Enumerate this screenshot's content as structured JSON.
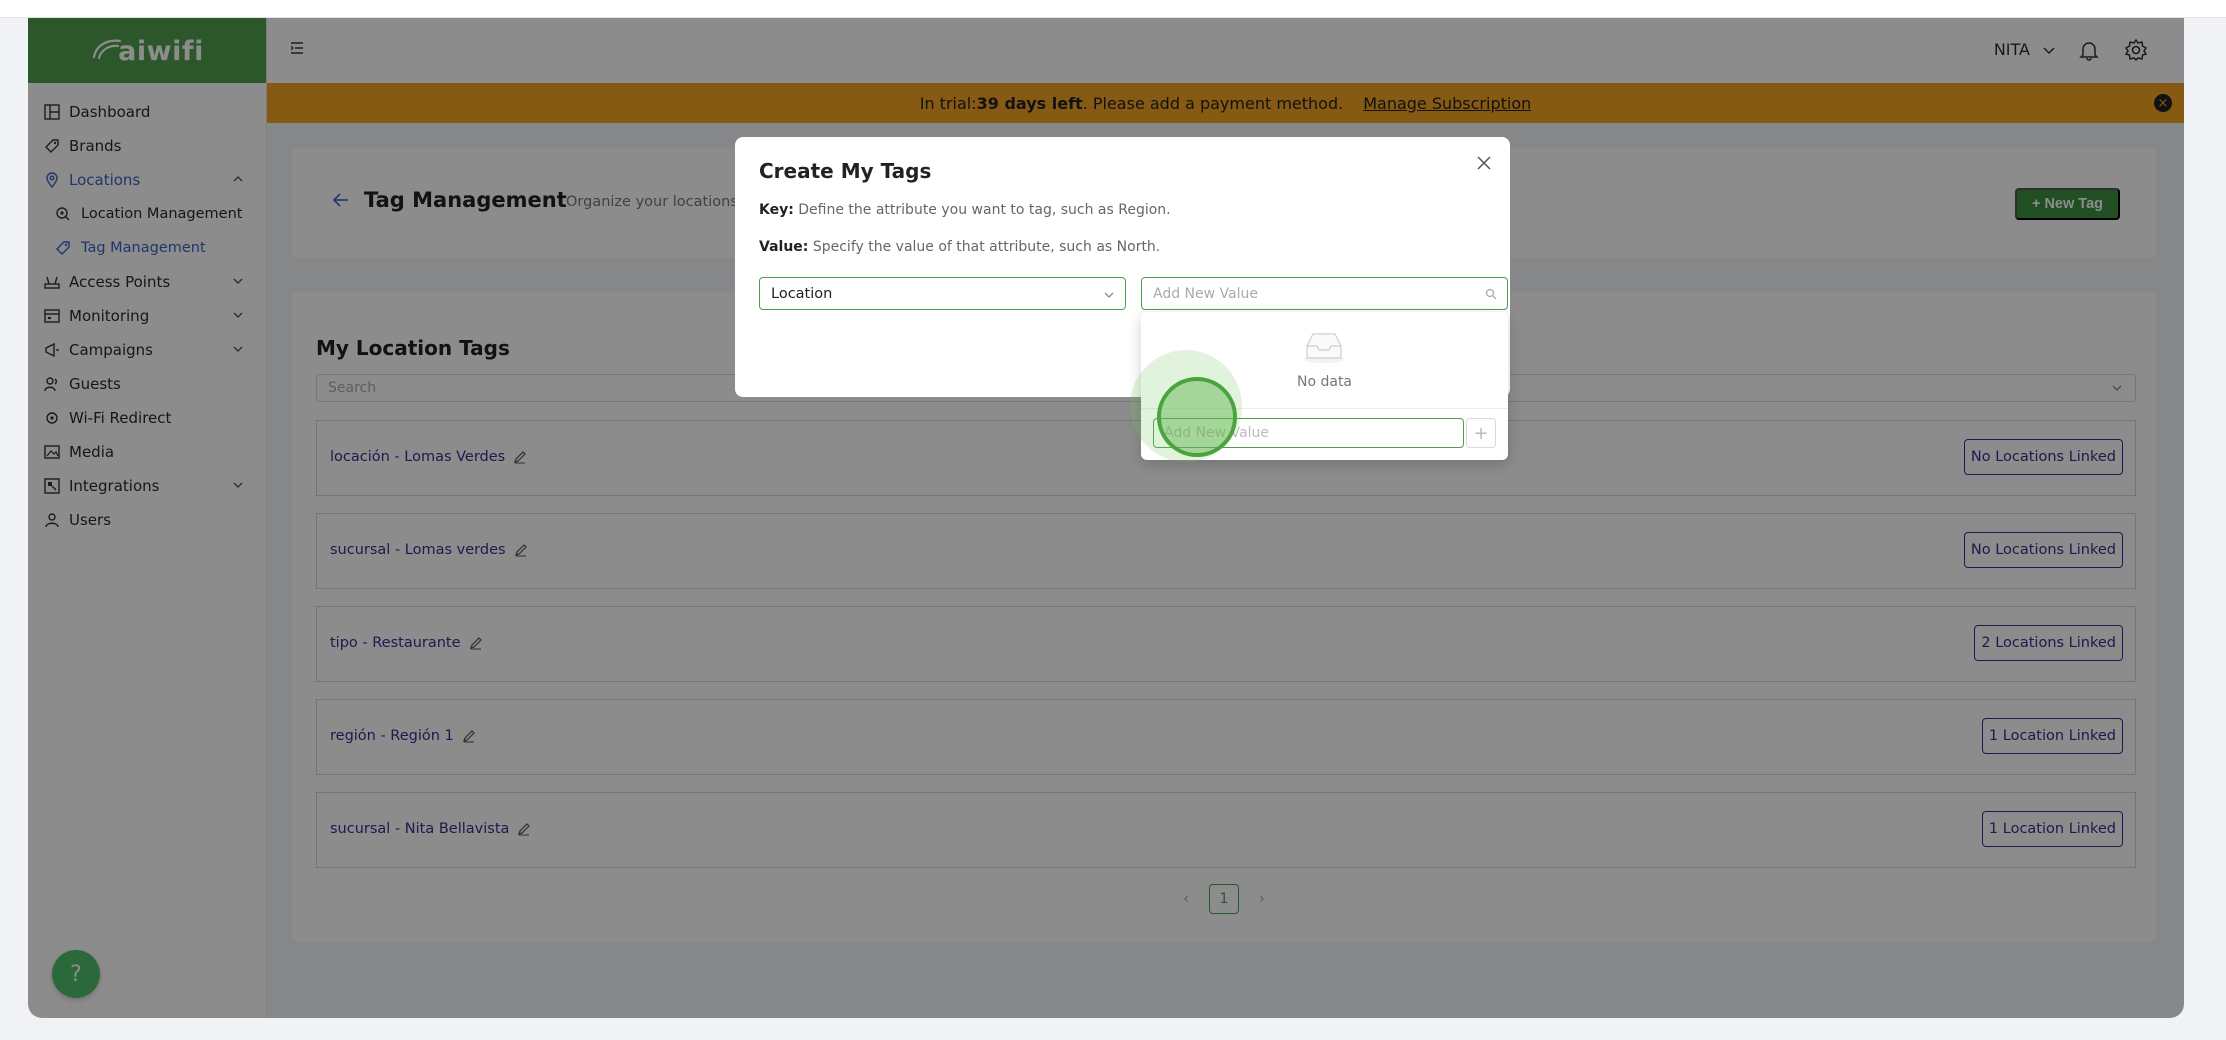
{
  "brand": {
    "logo_text": "aiwifi",
    "color": "#4f9e4d"
  },
  "sidebar": {
    "items": [
      {
        "label": "Dashboard",
        "icon": "dashboard-icon"
      },
      {
        "label": "Brands",
        "icon": "brands-icon"
      },
      {
        "label": "Locations",
        "icon": "location-pin-icon",
        "expanded": true,
        "children": [
          {
            "label": "Location Management",
            "icon": "location-management-icon"
          },
          {
            "label": "Tag Management",
            "icon": "tag-icon",
            "active": true
          }
        ]
      },
      {
        "label": "Access Points",
        "icon": "access-point-icon",
        "has_children": true
      },
      {
        "label": "Monitoring",
        "icon": "monitoring-icon",
        "has_children": true
      },
      {
        "label": "Campaigns",
        "icon": "megaphone-icon",
        "has_children": true
      },
      {
        "label": "Guests",
        "icon": "guests-icon"
      },
      {
        "label": "Wi-Fi Redirect",
        "icon": "redirect-icon"
      },
      {
        "label": "Media",
        "icon": "media-icon"
      },
      {
        "label": "Integrations",
        "icon": "integrations-icon",
        "has_children": true
      },
      {
        "label": "Users",
        "icon": "user-icon"
      }
    ]
  },
  "header": {
    "user": "NITA"
  },
  "banner": {
    "prefix": "In trial: ",
    "days": "39 days left",
    "suffix": ". Please add a payment method.",
    "manage": "Manage Subscription",
    "color": "#f4a523"
  },
  "page": {
    "title": "Tag Management",
    "subtitle": "Organize your locations us",
    "new_tag": "+ New Tag"
  },
  "tags": {
    "title": "My Location Tags",
    "search_placeholder": "Search",
    "rows": [
      {
        "label": "locación - Lomas Verdes",
        "badge": "No Locations Linked"
      },
      {
        "label": "sucursal - Lomas verdes",
        "badge": "No Locations Linked"
      },
      {
        "label": "tipo - Restaurante",
        "badge": "2 Locations Linked"
      },
      {
        "label": "región - Región 1",
        "badge": "1 Location Linked"
      },
      {
        "label": "sucursal - Nita Bellavista",
        "badge": "1 Location Linked"
      }
    ],
    "page": "1"
  },
  "modal": {
    "title": "Create My Tags",
    "key_label": "Key:",
    "key_text": "Define the attribute you want to tag, such as Region.",
    "value_label": "Value:",
    "value_text": "Specify the value of that attribute, such as North.",
    "key_value": "Location",
    "value_placeholder": "Add New Value",
    "dropdown": {
      "empty_text": "No data",
      "input_placeholder": "Add New Value",
      "add_symbol": "+"
    }
  },
  "help": {
    "label": "?"
  }
}
